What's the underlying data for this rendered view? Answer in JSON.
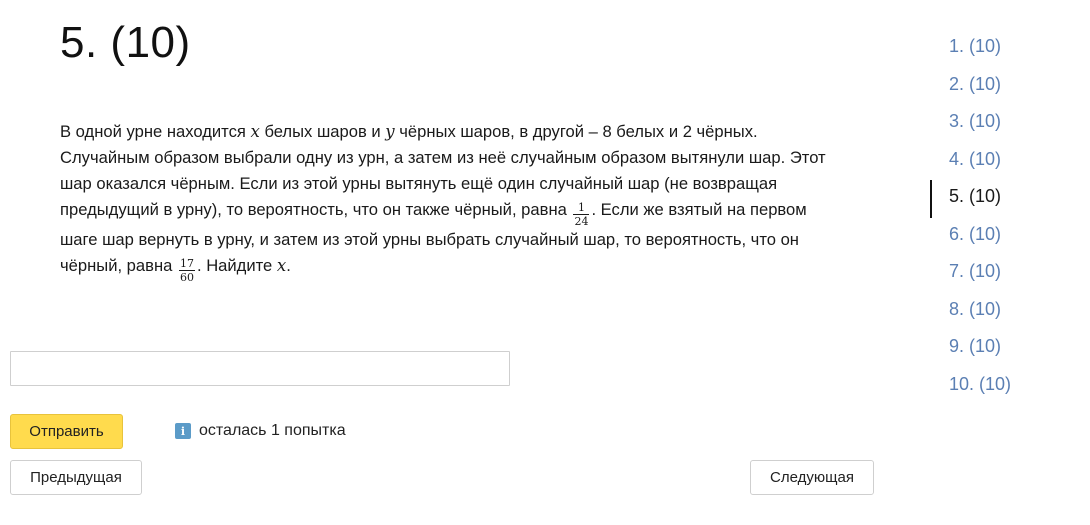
{
  "title": "5. (10)",
  "problem": {
    "p1": "В одной урне находится ",
    "var_x": "x",
    "p2": " белых шаров и ",
    "var_y": "y",
    "p3": " чёрных шаров, в другой – 8 белых и 2 чёрных. Случайным образом выбрали одну из урн, а затем из неё случайным образом вытянули шар. Этот шар оказался чёрным. Если из этой урны вытянуть ещё один случайный шар (не возвращая предыдущий в урну), то вероятность, что он также чёрный, равна ",
    "frac1_num": "1",
    "frac1_den": "24",
    "p4": ". Если же взятый на первом шаге шар вернуть в урну, и затем из этой урны выбрать случайный шар, то вероятность, что он чёрный, равна ",
    "frac2_num": "17",
    "frac2_den": "60",
    "p5": ". Найдите ",
    "var_x2": "x",
    "p6": "."
  },
  "answer": {
    "value": "",
    "placeholder": ""
  },
  "submit_label": "Отправить",
  "attempts": {
    "icon": "info-icon",
    "icon_glyph": "i",
    "text": "осталась 1 попытка"
  },
  "prev_label": "Предыдущая",
  "next_label": "Следующая",
  "nav": {
    "items": [
      "1. (10)",
      "2. (10)",
      "3. (10)",
      "4. (10)",
      "5. (10)",
      "6. (10)",
      "7. (10)",
      "8. (10)",
      "9. (10)",
      "10. (10)"
    ],
    "active_index": 4
  },
  "colors": {
    "accent": "#ffdb4d",
    "link": "#5b7fb3",
    "info": "#5b9bc8"
  }
}
